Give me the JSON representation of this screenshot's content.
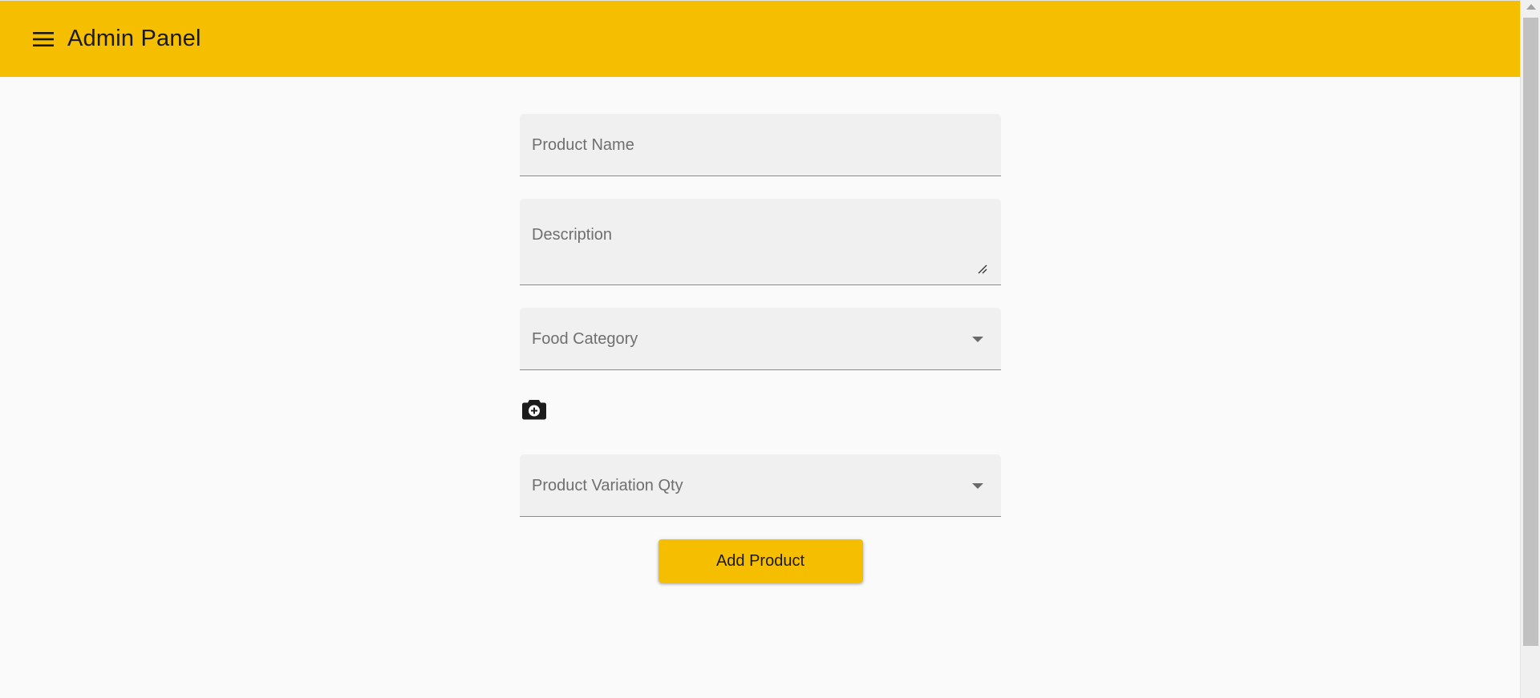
{
  "app_bar": {
    "title": "Admin Panel",
    "menu_icon": "menu-icon",
    "background": "#f5bf00"
  },
  "form": {
    "product_name": {
      "label": "Product Name",
      "value": ""
    },
    "description": {
      "label": "Description",
      "value": ""
    },
    "food_category": {
      "label": "Food Category",
      "selected": "",
      "icon": "chevron-down-icon"
    },
    "image_upload": {
      "icon": "add-a-photo-icon"
    },
    "product_variation_qty": {
      "label": "Product Variation Qty",
      "selected": "",
      "icon": "chevron-down-icon"
    },
    "submit_label": "Add Product"
  },
  "colors": {
    "accent": "#f5bf00",
    "field_bg": "#f0f0f0",
    "page_bg": "#fafafa"
  }
}
